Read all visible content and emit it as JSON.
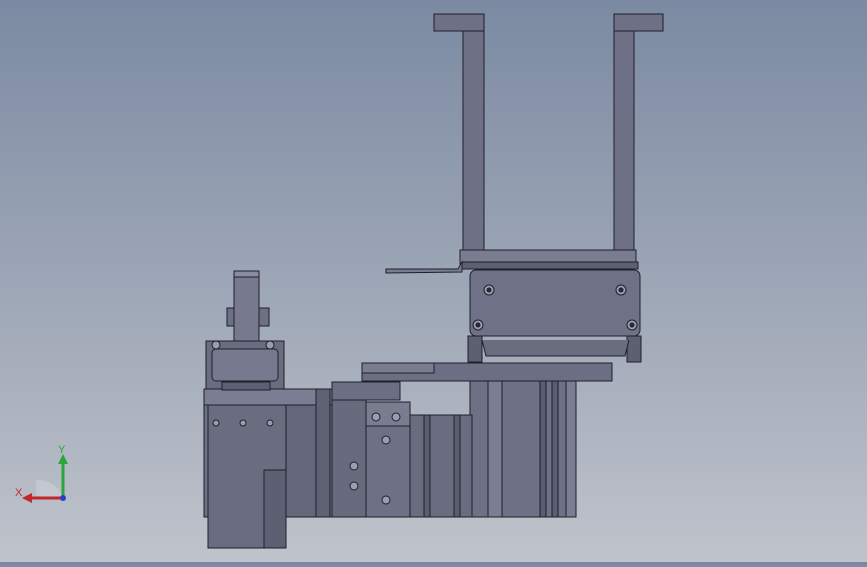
{
  "viewport": {
    "background_top": "#7b8aa2",
    "background_bottom": "#bfc3cb",
    "part_fill": "#6e7185",
    "part_fill_dark": "#56596b",
    "part_fill_light": "#82859a",
    "edge_color": "#1d1f2a"
  },
  "triad": {
    "x_label": "X",
    "y_label": "Y",
    "x_color": "#c0282a",
    "y_color": "#2aa53a",
    "z_color": "#2a3fc8",
    "icon": "axis-triad-icon"
  }
}
